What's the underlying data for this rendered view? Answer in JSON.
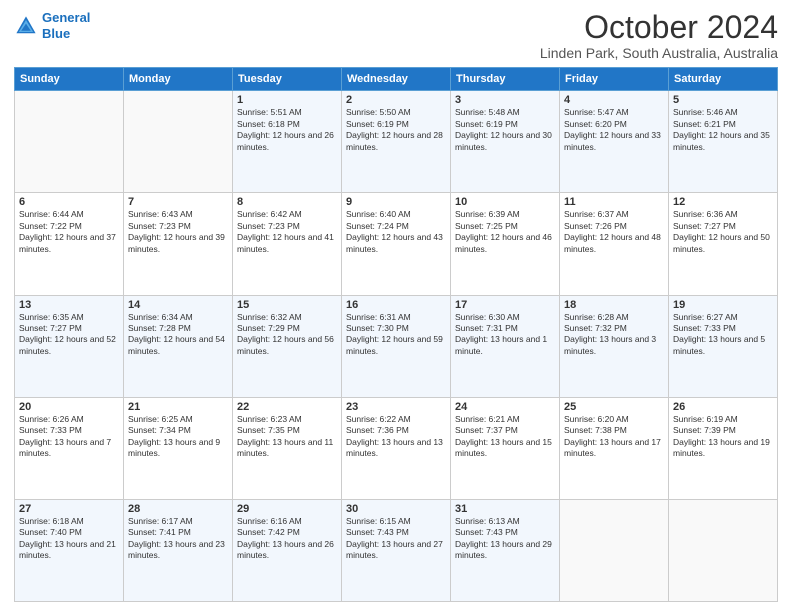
{
  "header": {
    "logo_line1": "General",
    "logo_line2": "Blue",
    "month_title": "October 2024",
    "location": "Linden Park, South Australia, Australia"
  },
  "weekdays": [
    "Sunday",
    "Monday",
    "Tuesday",
    "Wednesday",
    "Thursday",
    "Friday",
    "Saturday"
  ],
  "weeks": [
    [
      {
        "day": "",
        "sunrise": "",
        "sunset": "",
        "daylight": ""
      },
      {
        "day": "",
        "sunrise": "",
        "sunset": "",
        "daylight": ""
      },
      {
        "day": "1",
        "sunrise": "Sunrise: 5:51 AM",
        "sunset": "Sunset: 6:18 PM",
        "daylight": "Daylight: 12 hours and 26 minutes."
      },
      {
        "day": "2",
        "sunrise": "Sunrise: 5:50 AM",
        "sunset": "Sunset: 6:19 PM",
        "daylight": "Daylight: 12 hours and 28 minutes."
      },
      {
        "day": "3",
        "sunrise": "Sunrise: 5:48 AM",
        "sunset": "Sunset: 6:19 PM",
        "daylight": "Daylight: 12 hours and 30 minutes."
      },
      {
        "day": "4",
        "sunrise": "Sunrise: 5:47 AM",
        "sunset": "Sunset: 6:20 PM",
        "daylight": "Daylight: 12 hours and 33 minutes."
      },
      {
        "day": "5",
        "sunrise": "Sunrise: 5:46 AM",
        "sunset": "Sunset: 6:21 PM",
        "daylight": "Daylight: 12 hours and 35 minutes."
      }
    ],
    [
      {
        "day": "6",
        "sunrise": "Sunrise: 6:44 AM",
        "sunset": "Sunset: 7:22 PM",
        "daylight": "Daylight: 12 hours and 37 minutes."
      },
      {
        "day": "7",
        "sunrise": "Sunrise: 6:43 AM",
        "sunset": "Sunset: 7:23 PM",
        "daylight": "Daylight: 12 hours and 39 minutes."
      },
      {
        "day": "8",
        "sunrise": "Sunrise: 6:42 AM",
        "sunset": "Sunset: 7:23 PM",
        "daylight": "Daylight: 12 hours and 41 minutes."
      },
      {
        "day": "9",
        "sunrise": "Sunrise: 6:40 AM",
        "sunset": "Sunset: 7:24 PM",
        "daylight": "Daylight: 12 hours and 43 minutes."
      },
      {
        "day": "10",
        "sunrise": "Sunrise: 6:39 AM",
        "sunset": "Sunset: 7:25 PM",
        "daylight": "Daylight: 12 hours and 46 minutes."
      },
      {
        "day": "11",
        "sunrise": "Sunrise: 6:37 AM",
        "sunset": "Sunset: 7:26 PM",
        "daylight": "Daylight: 12 hours and 48 minutes."
      },
      {
        "day": "12",
        "sunrise": "Sunrise: 6:36 AM",
        "sunset": "Sunset: 7:27 PM",
        "daylight": "Daylight: 12 hours and 50 minutes."
      }
    ],
    [
      {
        "day": "13",
        "sunrise": "Sunrise: 6:35 AM",
        "sunset": "Sunset: 7:27 PM",
        "daylight": "Daylight: 12 hours and 52 minutes."
      },
      {
        "day": "14",
        "sunrise": "Sunrise: 6:34 AM",
        "sunset": "Sunset: 7:28 PM",
        "daylight": "Daylight: 12 hours and 54 minutes."
      },
      {
        "day": "15",
        "sunrise": "Sunrise: 6:32 AM",
        "sunset": "Sunset: 7:29 PM",
        "daylight": "Daylight: 12 hours and 56 minutes."
      },
      {
        "day": "16",
        "sunrise": "Sunrise: 6:31 AM",
        "sunset": "Sunset: 7:30 PM",
        "daylight": "Daylight: 12 hours and 59 minutes."
      },
      {
        "day": "17",
        "sunrise": "Sunrise: 6:30 AM",
        "sunset": "Sunset: 7:31 PM",
        "daylight": "Daylight: 13 hours and 1 minute."
      },
      {
        "day": "18",
        "sunrise": "Sunrise: 6:28 AM",
        "sunset": "Sunset: 7:32 PM",
        "daylight": "Daylight: 13 hours and 3 minutes."
      },
      {
        "day": "19",
        "sunrise": "Sunrise: 6:27 AM",
        "sunset": "Sunset: 7:33 PM",
        "daylight": "Daylight: 13 hours and 5 minutes."
      }
    ],
    [
      {
        "day": "20",
        "sunrise": "Sunrise: 6:26 AM",
        "sunset": "Sunset: 7:33 PM",
        "daylight": "Daylight: 13 hours and 7 minutes."
      },
      {
        "day": "21",
        "sunrise": "Sunrise: 6:25 AM",
        "sunset": "Sunset: 7:34 PM",
        "daylight": "Daylight: 13 hours and 9 minutes."
      },
      {
        "day": "22",
        "sunrise": "Sunrise: 6:23 AM",
        "sunset": "Sunset: 7:35 PM",
        "daylight": "Daylight: 13 hours and 11 minutes."
      },
      {
        "day": "23",
        "sunrise": "Sunrise: 6:22 AM",
        "sunset": "Sunset: 7:36 PM",
        "daylight": "Daylight: 13 hours and 13 minutes."
      },
      {
        "day": "24",
        "sunrise": "Sunrise: 6:21 AM",
        "sunset": "Sunset: 7:37 PM",
        "daylight": "Daylight: 13 hours and 15 minutes."
      },
      {
        "day": "25",
        "sunrise": "Sunrise: 6:20 AM",
        "sunset": "Sunset: 7:38 PM",
        "daylight": "Daylight: 13 hours and 17 minutes."
      },
      {
        "day": "26",
        "sunrise": "Sunrise: 6:19 AM",
        "sunset": "Sunset: 7:39 PM",
        "daylight": "Daylight: 13 hours and 19 minutes."
      }
    ],
    [
      {
        "day": "27",
        "sunrise": "Sunrise: 6:18 AM",
        "sunset": "Sunset: 7:40 PM",
        "daylight": "Daylight: 13 hours and 21 minutes."
      },
      {
        "day": "28",
        "sunrise": "Sunrise: 6:17 AM",
        "sunset": "Sunset: 7:41 PM",
        "daylight": "Daylight: 13 hours and 23 minutes."
      },
      {
        "day": "29",
        "sunrise": "Sunrise: 6:16 AM",
        "sunset": "Sunset: 7:42 PM",
        "daylight": "Daylight: 13 hours and 26 minutes."
      },
      {
        "day": "30",
        "sunrise": "Sunrise: 6:15 AM",
        "sunset": "Sunset: 7:43 PM",
        "daylight": "Daylight: 13 hours and 27 minutes."
      },
      {
        "day": "31",
        "sunrise": "Sunrise: 6:13 AM",
        "sunset": "Sunset: 7:43 PM",
        "daylight": "Daylight: 13 hours and 29 minutes."
      },
      {
        "day": "",
        "sunrise": "",
        "sunset": "",
        "daylight": ""
      },
      {
        "day": "",
        "sunrise": "",
        "sunset": "",
        "daylight": ""
      }
    ]
  ]
}
